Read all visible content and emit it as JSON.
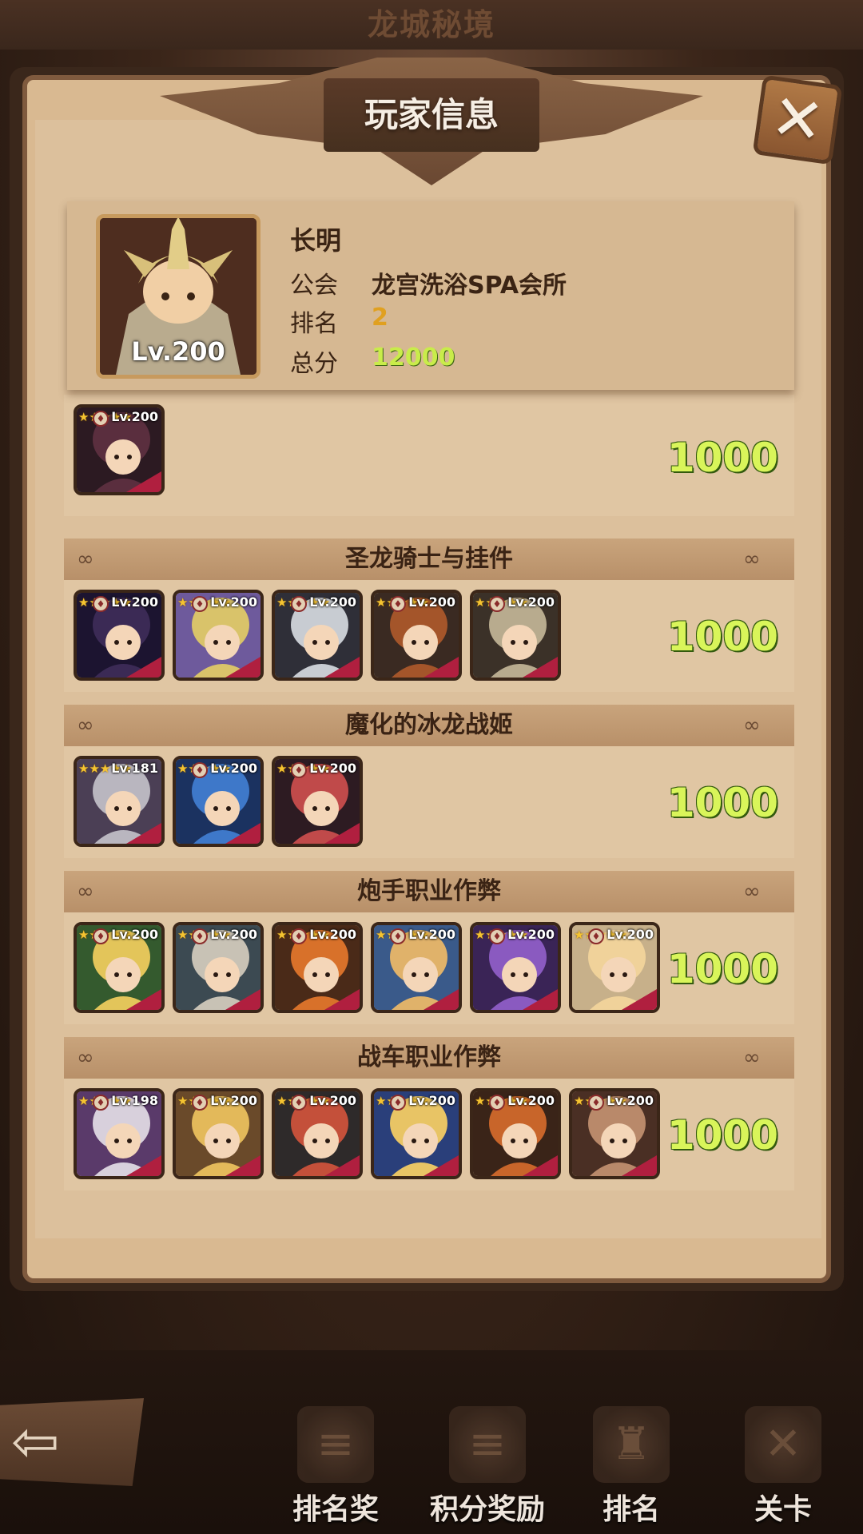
{
  "background": {
    "title": "龙城秘境"
  },
  "dialog": {
    "title": "玩家信息",
    "close_symbol": "✕"
  },
  "player": {
    "name": "长明",
    "avatar_level": "Lv.200",
    "guild_label": "公会",
    "guild": "龙宫洗浴SPA会所",
    "rank_label": "排名",
    "rank": "2",
    "score_label": "总分",
    "score": "12000"
  },
  "teams": [
    {
      "title": "",
      "score": "1000",
      "heroes": [
        {
          "level": "Lv.200",
          "colors": [
            "#5a2e3e",
            "#2c1a22"
          ]
        }
      ]
    },
    {
      "title": "圣龙骑士与挂件",
      "score": "1000",
      "heroes": [
        {
          "level": "Lv.200",
          "colors": [
            "#3b2a55",
            "#1c1430"
          ]
        },
        {
          "level": "Lv.200",
          "colors": [
            "#d9c36a",
            "#6e5a9c"
          ]
        },
        {
          "level": "Lv.200",
          "colors": [
            "#c8ccd2",
            "#2f2f38"
          ]
        },
        {
          "level": "Lv.200",
          "colors": [
            "#a4552a",
            "#3a2a22"
          ]
        },
        {
          "level": "Lv.200",
          "colors": [
            "#b8ab8e",
            "#3b3128"
          ]
        }
      ]
    },
    {
      "title": "魔化的冰龙战姬",
      "score": "1000",
      "heroes": [
        {
          "level": "Lv.181",
          "colors": [
            "#b9b6bf",
            "#4b3f55"
          ]
        },
        {
          "level": "Lv.200",
          "colors": [
            "#3e78c9",
            "#1b3260"
          ]
        },
        {
          "level": "Lv.200",
          "colors": [
            "#c04a4a",
            "#2d1b22"
          ]
        }
      ]
    },
    {
      "title": "炮手职业作弊",
      "score": "1000",
      "heroes": [
        {
          "level": "Lv.200",
          "colors": [
            "#e3c55a",
            "#345a2e"
          ]
        },
        {
          "level": "Lv.200",
          "colors": [
            "#c8c2b5",
            "#3c4a52"
          ]
        },
        {
          "level": "Lv.200",
          "colors": [
            "#d8712a",
            "#4a2a18"
          ]
        },
        {
          "level": "Lv.200",
          "colors": [
            "#e0b26a",
            "#3a5a8a"
          ]
        },
        {
          "level": "Lv.200",
          "colors": [
            "#8a5ac0",
            "#3a2456"
          ]
        },
        {
          "level": "Lv.200",
          "colors": [
            "#f0d29a",
            "#c7b08a"
          ]
        }
      ]
    },
    {
      "title": "战车职业作弊",
      "score": "1000",
      "heroes": [
        {
          "level": "Lv.198",
          "colors": [
            "#d8d0dc",
            "#5a3a6a"
          ]
        },
        {
          "level": "Lv.200",
          "colors": [
            "#e3b95a",
            "#6a4a2a"
          ]
        },
        {
          "level": "Lv.200",
          "colors": [
            "#c4503a",
            "#2e2a2a"
          ]
        },
        {
          "level": "Lv.200",
          "colors": [
            "#e8c465",
            "#2a3f7a"
          ]
        },
        {
          "level": "Lv.200",
          "colors": [
            "#c8652a",
            "#3a2418"
          ]
        },
        {
          "level": "Lv.200",
          "colors": [
            "#b9896a",
            "#4a2f24"
          ]
        }
      ]
    }
  ],
  "nav": {
    "back_symbol": "⇦",
    "items": [
      {
        "label": "排名奖",
        "icon": "scroll-icon"
      },
      {
        "label": "积分奖励",
        "icon": "scroll-icon"
      },
      {
        "label": "排名",
        "icon": "trophy-icon"
      },
      {
        "label": "关卡",
        "icon": "stage-icon"
      }
    ]
  },
  "colors": {
    "score_green": "#d9f55a",
    "rank_gold": "#e0a020",
    "panel": "#d9b991"
  }
}
